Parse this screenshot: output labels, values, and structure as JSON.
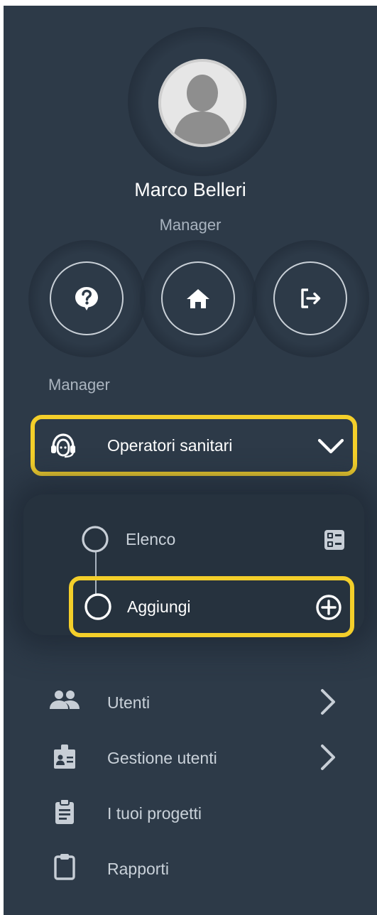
{
  "user": {
    "name": "Marco Belleri",
    "role": "Manager"
  },
  "actions": [
    {
      "icon": "help-icon"
    },
    {
      "icon": "home-icon"
    },
    {
      "icon": "logout-icon"
    }
  ],
  "section": {
    "label": "Manager"
  },
  "nav": {
    "operatori": {
      "label": "Operatori sanitari",
      "icon": "headset-icon",
      "expanded": true,
      "children": [
        {
          "label": "Elenco",
          "icon": "list-icon"
        },
        {
          "label": "Aggiungi",
          "icon": "add-circle-icon"
        }
      ]
    },
    "items": [
      {
        "label": "Utenti",
        "icon": "people-icon",
        "arrow": true
      },
      {
        "label": "Gestione utenti",
        "icon": "badge-icon",
        "arrow": true
      },
      {
        "label": "I tuoi progetti",
        "icon": "clipboard-text-icon",
        "arrow": false
      },
      {
        "label": "Rapporti",
        "icon": "clipboard-icon",
        "arrow": false
      }
    ]
  },
  "colors": {
    "sidebar_bg": "#2d3a48",
    "highlight": "#f4cf2a",
    "text": "#ffffff",
    "muted": "#aab4bf"
  }
}
